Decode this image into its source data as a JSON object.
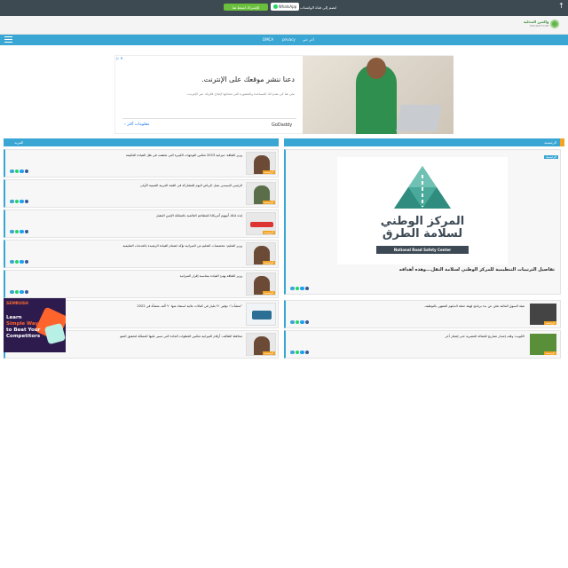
{
  "topbar": {
    "message": "انضم إلى قناة الواتساب",
    "whatsapp_label": "WhatsApp",
    "subscribe_label": "للإشتراك اضغط هنا"
  },
  "site": {
    "logo_name": "والعين المحلية",
    "logo_sub": "ROD-BATT.COM"
  },
  "nav": {
    "links": [
      "أخر خبر",
      "privacy",
      "DMCA"
    ]
  },
  "ad": {
    "title": "دعنا ننشر موقعك على الإنترنت.",
    "description": "نحن هنا كي نقدم لك المساعدة والمشورة التي تحتاجها لإنجاح فكرتك عبر الإنترنت.",
    "cta": "معلومات أكثر",
    "brand": "GoDaddy"
  },
  "sections": {
    "right_label": "الرئيسية",
    "left_label": "المزيد"
  },
  "left_cards": [
    {
      "headline": "وزير الثقافة: ميزانية 2023 تعكس التوجهات الكبيرة التي تحققت في ظل القيادة الحكيمة",
      "tag": "الرئيسية"
    },
    {
      "headline": "الرئيس السيسي يصل الرياض اليوم للمشاركة في القمة العربية الصينية الأولى",
      "tag": "الرئيسية"
    },
    {
      "headline": "إنذه لذلك أنبهوم أمريكانا للمطاعم العالمية بالمملكة الإثنين المقبل",
      "tag": "الرئيسية"
    },
    {
      "headline": "وزير التعليم: مخصصات التعليم من الميزانية تؤكد اهتمام القيادة الرشيدة بالخدمات التعليمية",
      "tag": "الرئيسية"
    },
    {
      "headline": "وزير الثقافة يهنئ القيادة بمناسبة إقرار الميزانية",
      "tag": "الرئيسية"
    },
    {
      "headline": "\"منشآت\": توفير ٢١ مليار في كفالات مالية استفاد منها ٩٠ ألف منشأة في 2022",
      "tag": "الرئيسية"
    },
    {
      "headline": "محافظ الطائف: أرقام الميزانية تعكس الخطوات الجادة التي تسير عليها المملكة لتحقيق النمو",
      "tag": "الرئيسية"
    }
  ],
  "feature": {
    "tag": "الرئيسية",
    "headline": "تفاصيل الترتيبات التنظيمية للمركز الوطني لسلامة النقل...وهذه أهدافه",
    "logo_ar": "المركز الوطني لسلامة الطرق",
    "logo_en": "National Road Safety Center"
  },
  "right_cards": [
    {
      "headline": "هيئة السوق المالية تعلن عن بدء برنامج لهيئة حملة الدبلوم المنتهي بالتوظيف",
      "tag": "الرئيسية"
    },
    {
      "headline": "الكويت: وقف إصدار تصاريح للعمالة المصرية حتى إشعار آخر",
      "tag": "الرئيسية"
    }
  ],
  "semrush": {
    "brand": "SEMRUSH",
    "line1": "Learn",
    "line2": "Simple Ways",
    "line3": "to Beat Your",
    "line4": "Competitors"
  },
  "colors": {
    "topbar": "#3d4a52",
    "nav": "#3aa6d3",
    "accent": "#f3a221",
    "subscribe": "#6abf3c"
  }
}
